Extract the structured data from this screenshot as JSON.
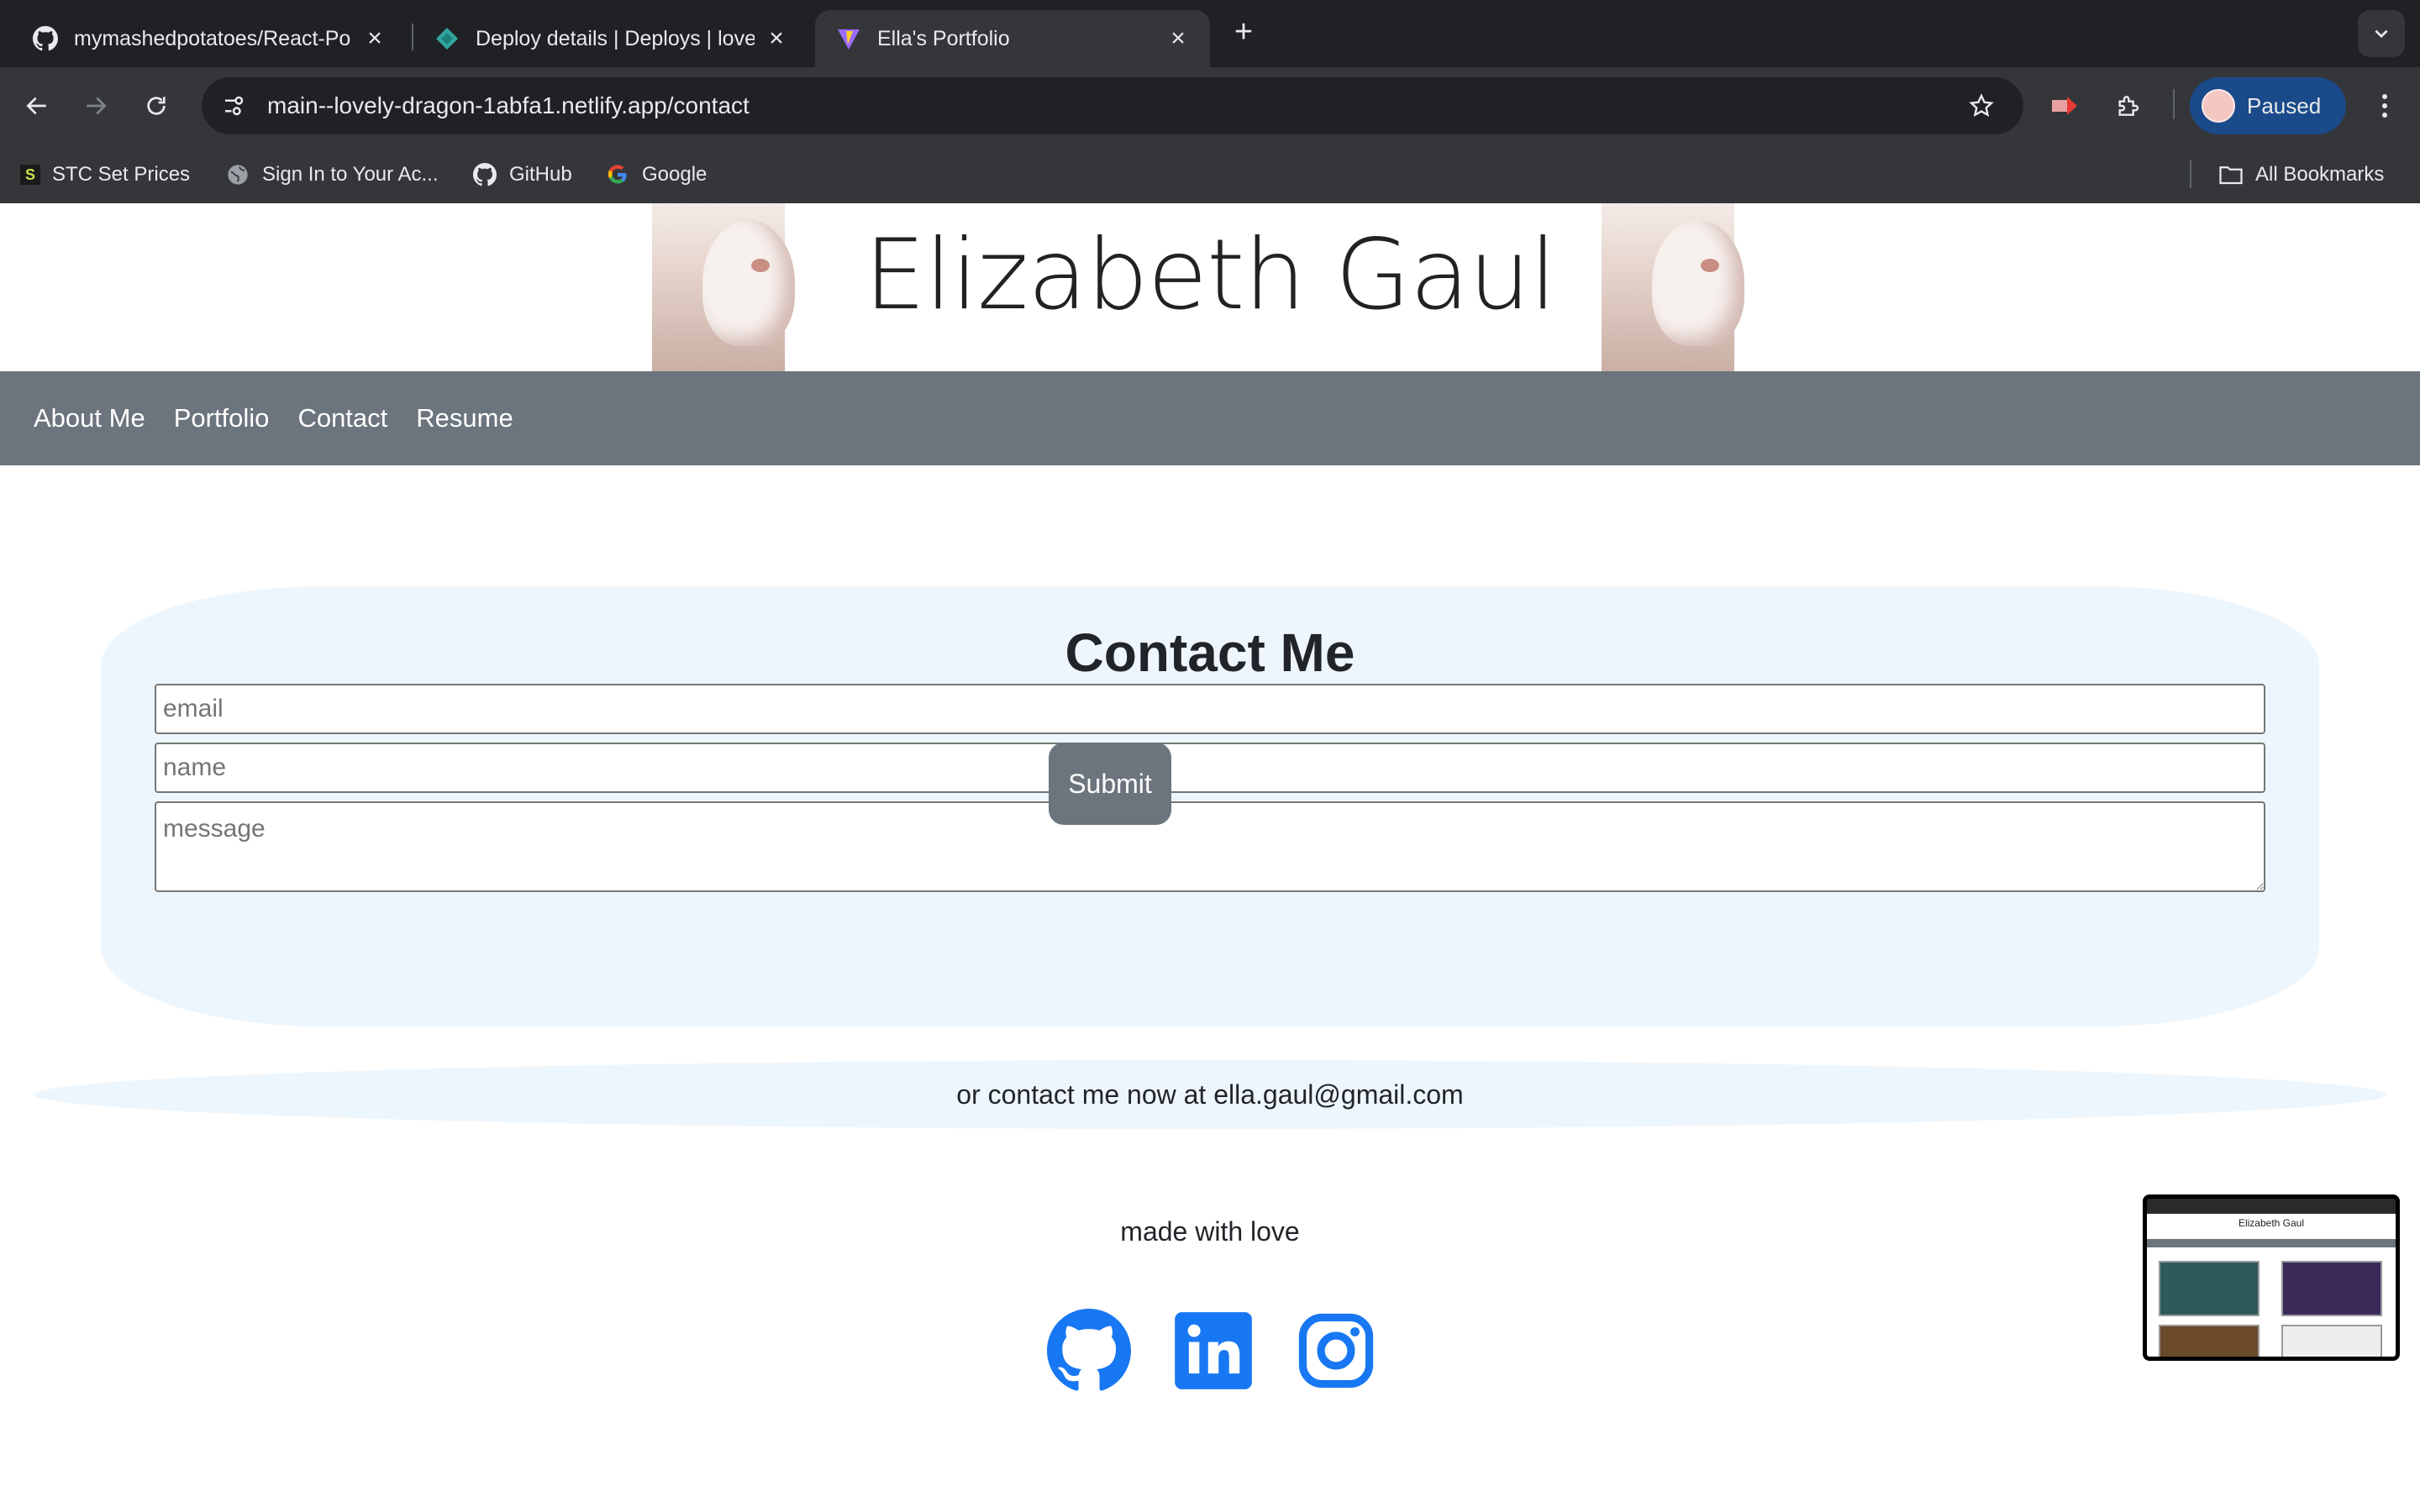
{
  "browser": {
    "tabs": [
      {
        "title": "mymashedpotatoes/React-Po",
        "icon": "github-icon"
      },
      {
        "title": "Deploy details | Deploys | love",
        "icon": "netlify-icon"
      },
      {
        "title": "Ella's Portfolio",
        "icon": "vite-icon"
      }
    ],
    "url": "main--lovely-dragon-1abfa1.netlify.app/contact",
    "profile_label": "Paused",
    "bookmarks": [
      {
        "label": "STC Set Prices",
        "icon": "s-icon"
      },
      {
        "label": "Sign In to Your Ac...",
        "icon": "globe-icon"
      },
      {
        "label": "GitHub",
        "icon": "github-icon"
      },
      {
        "label": "Google",
        "icon": "google-icon"
      }
    ],
    "all_bookmarks": "All Bookmarks"
  },
  "site": {
    "title": "Elizabeth Gaul",
    "nav": [
      "About Me",
      "Portfolio",
      "Contact",
      "Resume"
    ]
  },
  "contact": {
    "heading": "Contact Me",
    "email_placeholder": "email",
    "name_placeholder": "name",
    "message_placeholder": "message",
    "submit_label": "Submit",
    "alt_text": "or contact me now at ella.gaul@gmail.com"
  },
  "footer": {
    "text": "made with love",
    "social_icons": [
      "github-icon",
      "linkedin-icon",
      "instagram-icon"
    ]
  },
  "thumbnail": {
    "title": "Elizabeth Gaul"
  },
  "colors": {
    "tab_bg": "#202124",
    "toolbar_bg": "#35363a",
    "nav_bg": "#6c757d",
    "card_bg": "#eef6fd",
    "social_blue": "#1877f2"
  }
}
